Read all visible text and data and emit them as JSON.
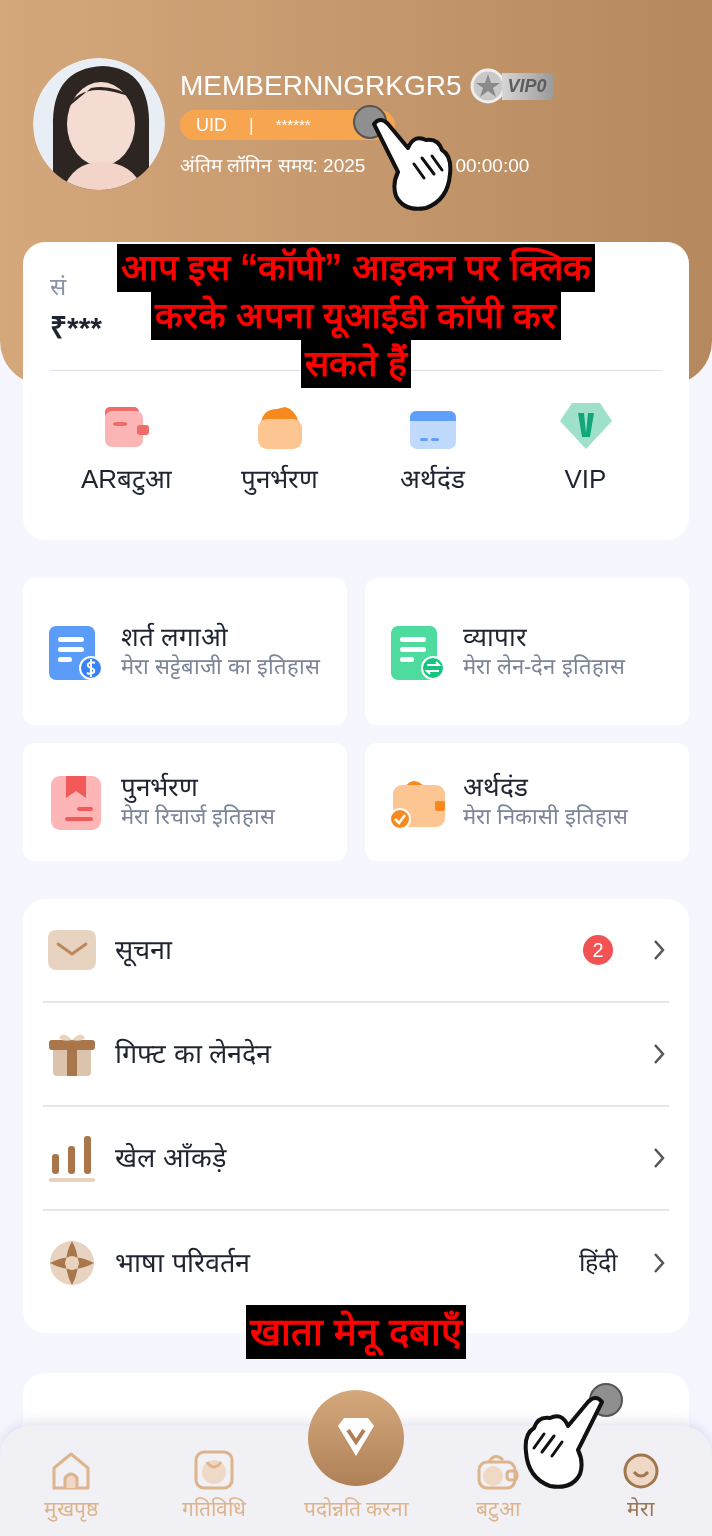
{
  "profile": {
    "username": "MEMBERNNGRKGR5",
    "vip_badge": "VIP0",
    "uid_label": "UID",
    "uid_separator": "|",
    "uid_value": "******",
    "last_login": "अंतिम लॉगिन समय: 2025",
    "last_login_tail": "00:00:00"
  },
  "balance": {
    "label": "सं",
    "amount": "₹***"
  },
  "quick_actions": [
    {
      "kind": "wallet",
      "label": "ARबटुआ"
    },
    {
      "kind": "recharge",
      "label": "पुनर्भरण"
    },
    {
      "kind": "withdraw",
      "label": "अर्थदंड"
    },
    {
      "kind": "vip",
      "label": "VIP"
    }
  ],
  "history_cards": [
    {
      "kind": "bet",
      "title": "शर्त लगाओ",
      "subtitle": "मेरा सट्टेबाजी का इतिहास"
    },
    {
      "kind": "trade",
      "title": "व्यापार",
      "subtitle": "मेरा लेन-देन इतिहास"
    },
    {
      "kind": "recharge",
      "title": "पुनर्भरण",
      "subtitle": "मेरा रिचार्ज इतिहास"
    },
    {
      "kind": "withdraw",
      "title": "अर्थदंड",
      "subtitle": "मेरा निकासी इतिहास"
    }
  ],
  "menu": [
    {
      "kind": "notice",
      "label": "सूचना",
      "badge": "2"
    },
    {
      "kind": "gift",
      "label": "गिफ्ट का लेनदेन"
    },
    {
      "kind": "stats",
      "label": "खेल आँकड़े"
    },
    {
      "kind": "language",
      "label": "भाषा परिवर्तन",
      "value": "हिंदी"
    }
  ],
  "tutorial_top": [
    "आप इस “कॉपी” आइकन पर क्लिक",
    "करके अपना यूआईडी कॉपी कर",
    "सकते हैं"
  ],
  "tutorial_bottom": [
    "खाता मेनू दबाएँ"
  ],
  "nav": [
    {
      "kind": "home",
      "label": "मुखपृष्ठ",
      "selected": false
    },
    {
      "kind": "activity",
      "label": "गतिविधि",
      "selected": false
    },
    {
      "kind": "promo",
      "label": "पदोन्नति करना",
      "selected": false
    },
    {
      "kind": "wallet",
      "label": "बटुआ",
      "selected": false
    },
    {
      "kind": "me",
      "label": "मेरा",
      "selected": true
    }
  ]
}
